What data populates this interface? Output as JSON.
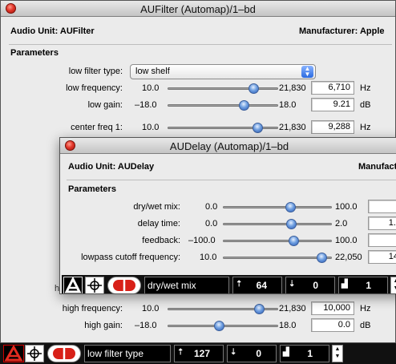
{
  "background": {
    "fragment_left": "A",
    "fragment_left2": "h"
  },
  "aufilter": {
    "title": "AUFilter (Automap)/1–bd",
    "audio_unit_label": "Audio Unit: AUFilter",
    "manufacturer_label": "Manufacturer: Apple",
    "parameters_label": "Parameters",
    "filter_type_label": "low filter type:",
    "filter_type_value": "low shelf",
    "rows": [
      {
        "label": "low frequency:",
        "min": "10.0",
        "max": "21,830",
        "value": "6,710",
        "unit": "Hz"
      },
      {
        "label": "low gain:",
        "min": "–18.0",
        "max": "18.0",
        "value": "9.21",
        "unit": "dB"
      },
      {
        "label": "center freq 1:",
        "min": "10.0",
        "max": "21,830",
        "value": "9,288",
        "unit": "Hz"
      },
      {
        "label": "high frequency:",
        "min": "10.0",
        "max": "21,830",
        "value": "10,000",
        "unit": "Hz"
      },
      {
        "label": "high gain:",
        "min": "–18.0",
        "max": "18.0",
        "value": "0.0",
        "unit": "dB"
      }
    ],
    "bar": {
      "control_name": "low filter type",
      "field1": "127",
      "field2": "0",
      "field3": "1"
    }
  },
  "audelay": {
    "title": "AUDelay (Automap)/1–bd",
    "audio_unit_label": "Audio Unit: AUDelay",
    "manufacturer_label": "Manufactu",
    "parameters_label": "Parameters",
    "rows": [
      {
        "label": "dry/wet mix:",
        "min": "0.0",
        "max": "100.0",
        "value": "6"
      },
      {
        "label": "delay time:",
        "min": "0.0",
        "max": "2.0",
        "value": "1.2"
      },
      {
        "label": "feedback:",
        "min": "–100.0",
        "max": "100.0",
        "value": "3"
      },
      {
        "label": "lowpass cutoff frequency:",
        "min": "10.0",
        "max": "22,050",
        "value": "14,"
      }
    ],
    "bar": {
      "control_name": "dry/wet mix",
      "field1": "64",
      "field2": "0",
      "field3": "1"
    }
  },
  "colors": {
    "knob": "#2b5cb8",
    "bar_bg": "#000000",
    "close_button": "#e2362a"
  }
}
